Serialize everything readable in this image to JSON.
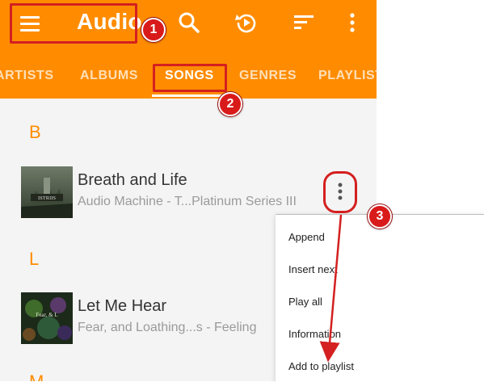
{
  "toolbar": {
    "title": "Audio",
    "menu_icon": "hamburger-menu-icon",
    "search_icon": "search-icon",
    "history_icon": "history-icon",
    "sort_icon": "sort-icon",
    "overflow_icon": "more-vertical-icon"
  },
  "tabs": [
    "ARTISTS",
    "ALBUMS",
    "SONGS",
    "GENRES",
    "PLAYLISTS"
  ],
  "active_tab": "SONGS",
  "sections": [
    {
      "letter": "B",
      "songs": [
        {
          "title": "Breath and Life",
          "subtitle": "Audio Machine - T...Platinum Series III"
        }
      ]
    },
    {
      "letter": "L",
      "songs": [
        {
          "title": "Let Me Hear",
          "subtitle": "Fear, and Loathing...s - Feeling"
        }
      ]
    },
    {
      "letter": "M",
      "songs": []
    }
  ],
  "context_menu": [
    "Append",
    "Insert next",
    "Play all",
    "Information",
    "Add to playlist"
  ],
  "annotations": [
    "1",
    "2",
    "3"
  ],
  "colors": {
    "accent": "#ff8c00",
    "annotation": "#d42020"
  }
}
